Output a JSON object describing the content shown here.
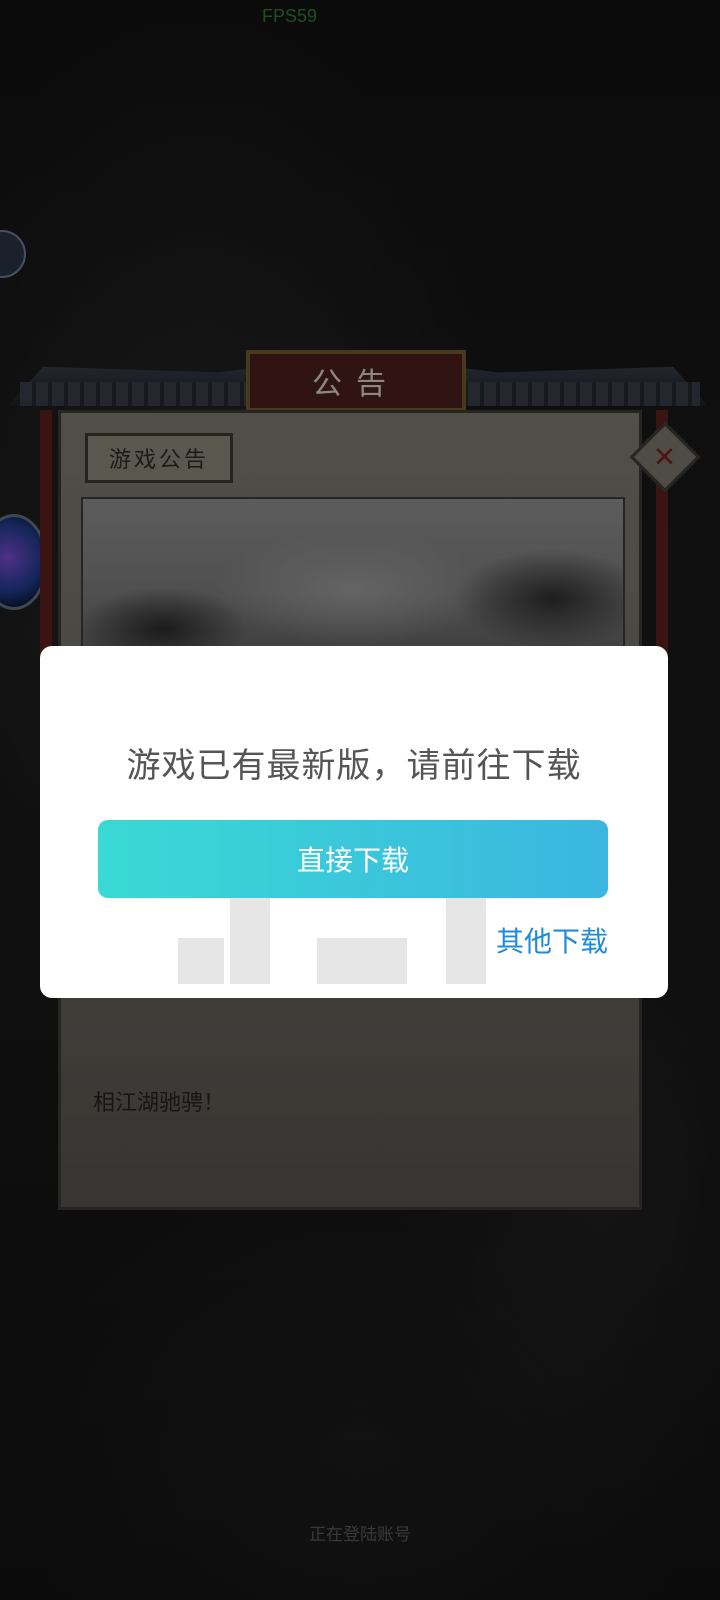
{
  "status": {
    "fps": "FPS59"
  },
  "board": {
    "title": "公告",
    "sub_title": "游戏公告",
    "body_text_fragment": "相江湖驰骋！"
  },
  "dialog": {
    "message": "游戏已有最新版，请前往下载",
    "direct_download": "直接下载",
    "other_download": "其他下载",
    "accent_start": "#3ad9d4",
    "accent_end": "#3bb6e0",
    "link_color": "#1f8bd8"
  },
  "footer": {
    "login_status": "正在登陆账号"
  },
  "icons": [
    "avatar-badge-icon",
    "orb-icon",
    "close-icon"
  ]
}
